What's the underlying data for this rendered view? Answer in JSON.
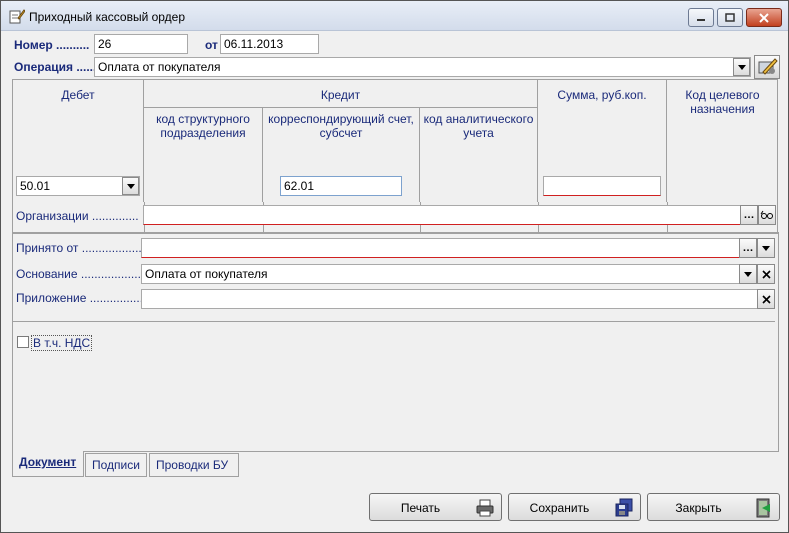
{
  "window": {
    "title": "Приходный кассовый ордер"
  },
  "header": {
    "number_label": "Номер ..........",
    "number_value": "26",
    "date_label": "от",
    "date_value": "06.11.2013",
    "operation_label": "Операция ......",
    "operation_value": "Оплата от покупателя"
  },
  "grid": {
    "debet": "Дебет",
    "kredit": "Кредит",
    "struct_code": "код структурного подразделения",
    "corr_account": "корреспондирующий счет, субсчет",
    "analytic_code": "код аналитического учета",
    "summa": "Сумма, руб.коп.",
    "target_code": "Код целевого назначения",
    "debet_value": "50.01",
    "corr_value": "62.01",
    "summa_value": ""
  },
  "fields": {
    "organizations_label": "Организации ..............",
    "organizations_value": "",
    "received_from_label": "Принято от ..................",
    "received_from_value": "",
    "basis_label": "Основание ...................",
    "basis_value": "Оплата от покупателя",
    "attachment_label": "Приложение ..................",
    "attachment_value": "",
    "vat_label": "В т.ч. НДС"
  },
  "tabs": [
    "Документ",
    "Подписи",
    "Проводки БУ"
  ],
  "buttons": {
    "print": "Печать",
    "save": "Сохранить",
    "close": "Закрыть"
  },
  "colors": {
    "label": "#1a2a7a",
    "required_underline": "#d02020"
  }
}
